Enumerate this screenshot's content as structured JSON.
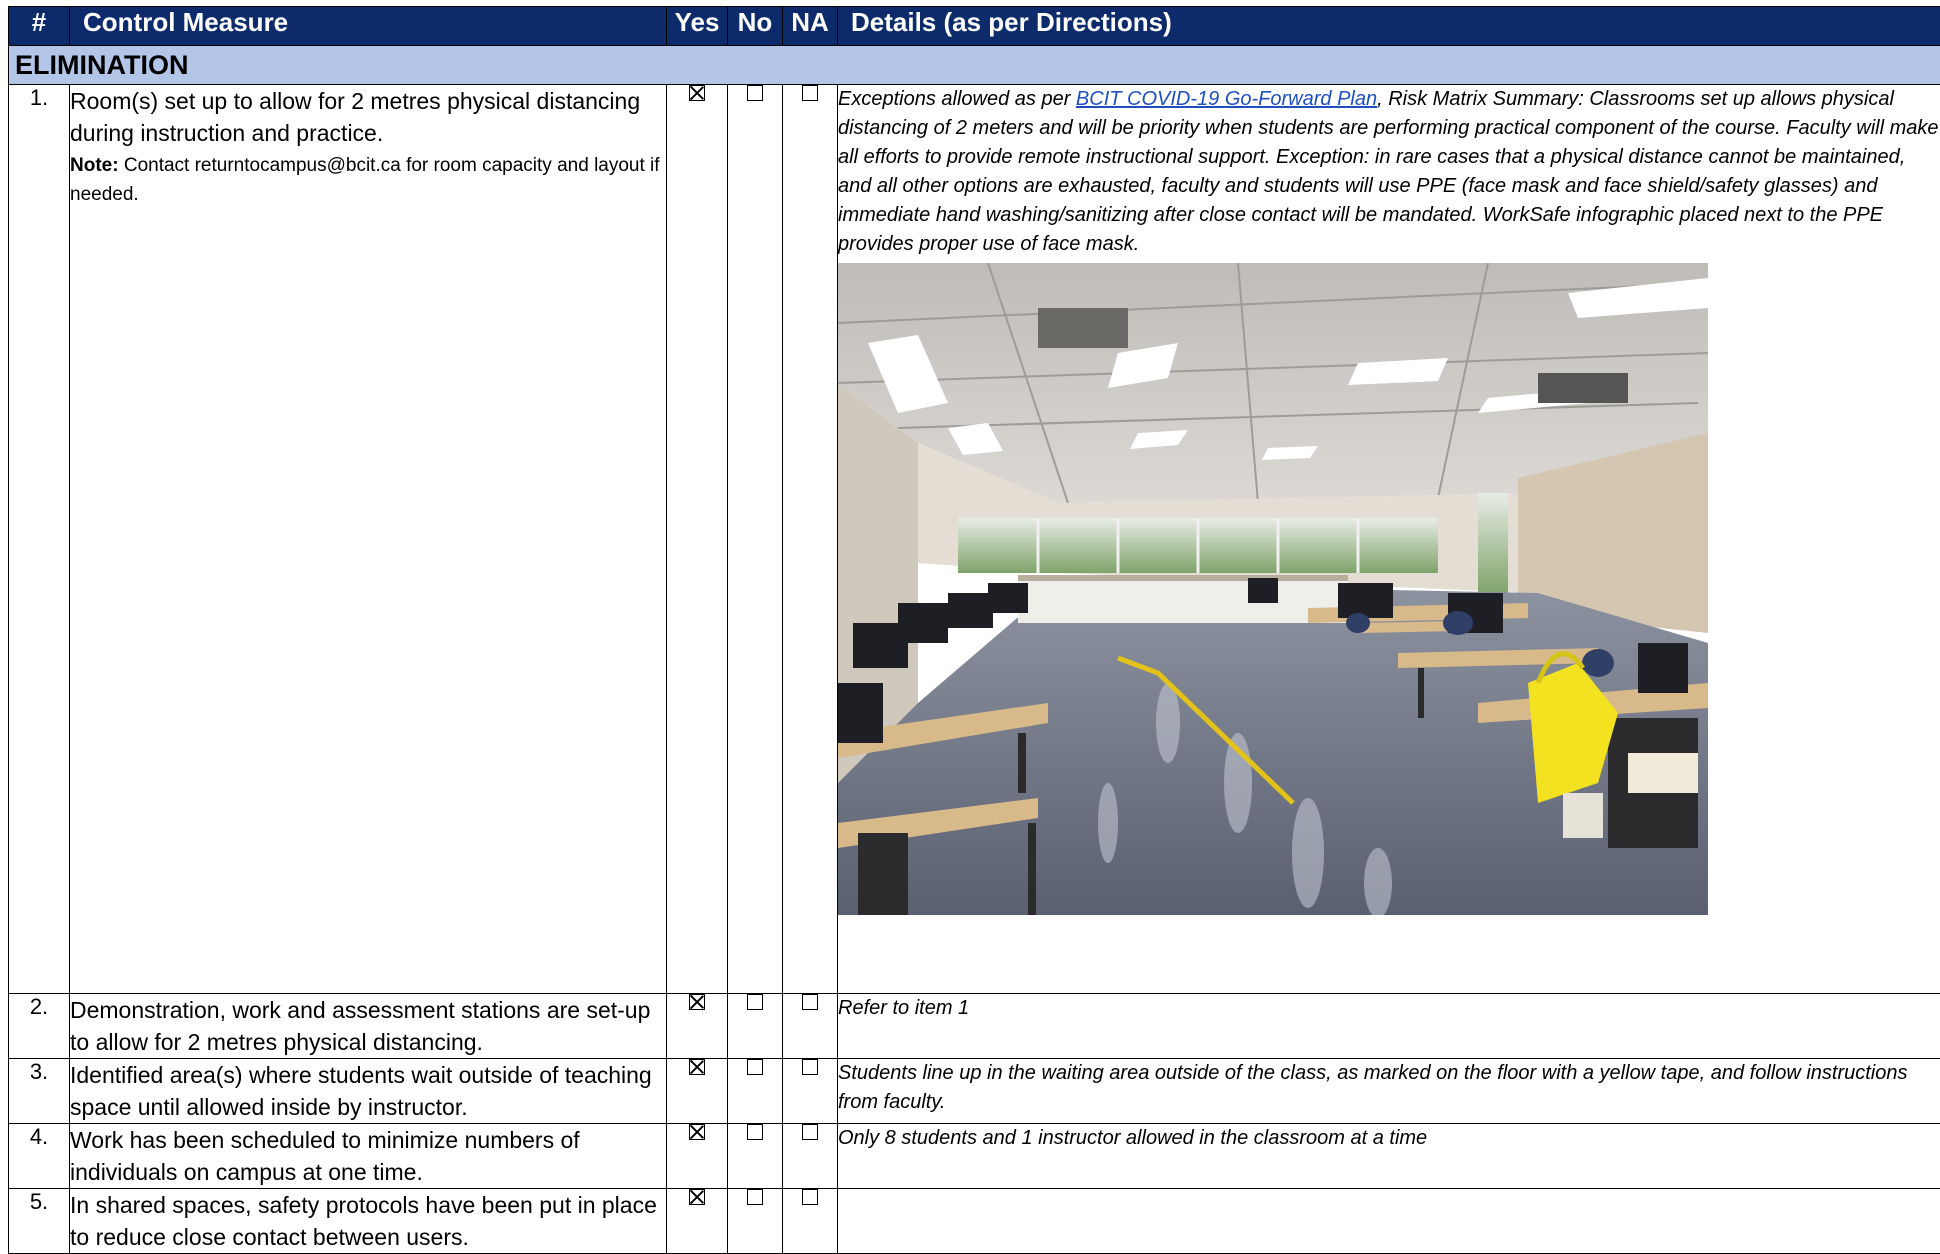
{
  "header": {
    "num": "#",
    "measure": "Control Measure",
    "yes": "Yes",
    "no": "No",
    "na": "NA",
    "details": "Details (as per Directions)"
  },
  "section": {
    "title": "ELIMINATION"
  },
  "rows": [
    {
      "num": "1.",
      "measure": "Room(s) set up to allow for 2 metres physical distancing during instruction and practice.",
      "note_label": "Note:",
      "note_text": " Contact returntocampus@bcit.ca for room capacity and layout if needed.",
      "yes": true,
      "no": false,
      "na": false,
      "details_prefix": "Exceptions allowed as per ",
      "details_link": "BCIT COVID-19 Go-Forward Plan",
      "details_suffix": ", Risk Matrix Summary: Classrooms set up allows physical distancing of 2 meters and will be priority when students are performing practical component of the course. Faculty will make all efforts to provide remote instructional support. Exception: in rare cases that a physical distance cannot be maintained, and all other options are exhausted, faculty and students will use PPE (face mask and face shield/safety glasses) and immediate hand washing/sanitizing after close contact will be mandated. WorkSafe infographic placed next to the PPE provides proper use of face mask."
    },
    {
      "num": "2.",
      "measure": "Demonstration, work and assessment stations are set-up to allow for 2 metres physical distancing.",
      "yes": true,
      "no": false,
      "na": false,
      "details": "Refer to item 1"
    },
    {
      "num": "3.",
      "measure": "Identified area(s) where students wait outside of teaching space until allowed inside by instructor.",
      "yes": true,
      "no": false,
      "na": false,
      "details": "Students line up in the waiting area outside of the class, as marked on the floor with a yellow tape, and follow instructions from faculty."
    },
    {
      "num": "4.",
      "measure": "Work has been scheduled to minimize numbers of individuals on campus at one time.",
      "yes": true,
      "no": false,
      "na": false,
      "details": "Only 8 students and 1 instructor allowed in the classroom at a time"
    },
    {
      "num": "5.",
      "measure": "In shared spaces, safety protocols have been put in place to reduce close contact between users.",
      "yes": true,
      "no": false,
      "na": false,
      "details": ""
    }
  ]
}
